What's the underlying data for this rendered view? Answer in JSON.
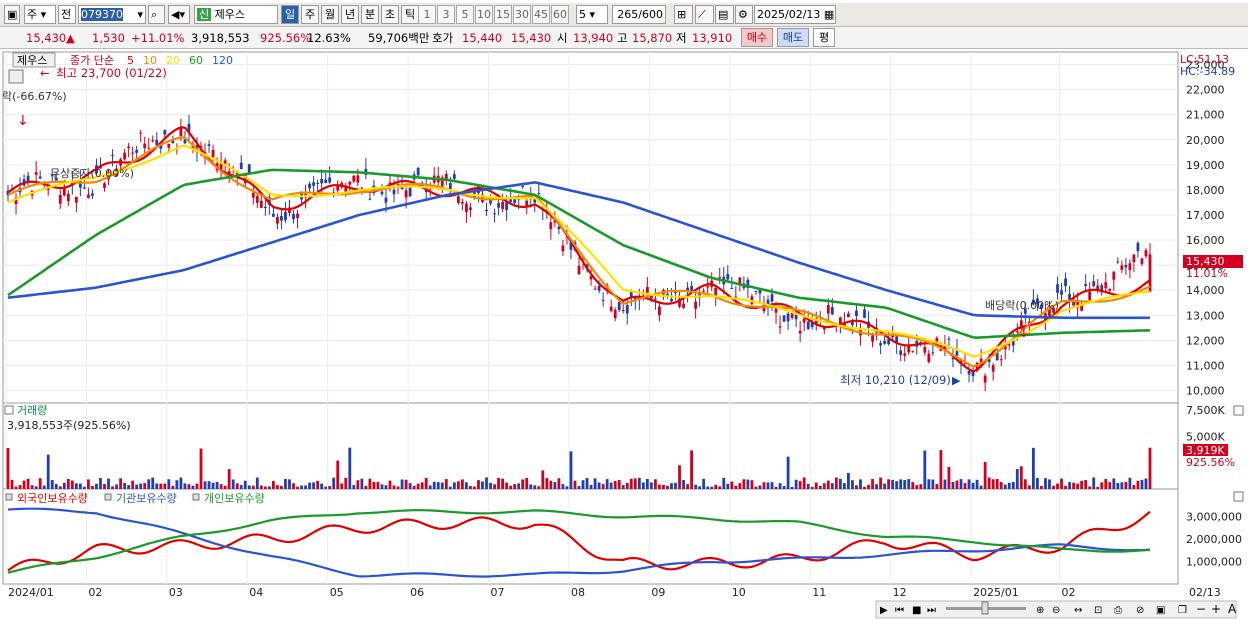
{
  "toolbar": {
    "market": "주",
    "scope": "전",
    "code": "079370",
    "tag": "신",
    "name": "제우스",
    "periods": [
      "일",
      "주",
      "월",
      "년",
      "분",
      "초",
      "틱"
    ],
    "active_period": "일",
    "nums": [
      "1",
      "3",
      "5",
      "10",
      "15",
      "30",
      "45",
      "60"
    ],
    "count_sel": "5",
    "bars": "265",
    "bars_total": "/600",
    "date": "2025/02/13"
  },
  "quote": {
    "price": "15,430",
    "arrow": "▲",
    "change": "1,530",
    "rate": "+11.01%",
    "volume": "3,918,553",
    "vol_ratio": "925.56%",
    "turnover": "12.63%",
    "amount": "59,706백만",
    "bid_label": "호가",
    "ask": "15,440",
    "bid": "15,430",
    "open_label": "시",
    "open": "13,940",
    "high_label": "고",
    "high": "15,870",
    "low_label": "저",
    "low": "13,910",
    "buy": "매수",
    "sell": "매도",
    "eval": "평"
  },
  "price_panel": {
    "stock_tag": "제우스",
    "legend_prefix": "종가 단순",
    "ma_periods": [
      {
        "label": "5",
        "color": "#e00000"
      },
      {
        "label": "10",
        "color": "#f08a00"
      },
      {
        "label": "20",
        "color": "#ffe000"
      },
      {
        "label": "60",
        "color": "#1a9a2a"
      },
      {
        "label": "120",
        "color": "#2a55d0"
      }
    ],
    "high_note": "최고 23,700 (01/22)",
    "low_note": "최저 10,210 (12/09)",
    "drop_note": "락(-66.67%)",
    "event1": "무상증자(0.00%)",
    "event2": "배당락(0.00%)",
    "lc": "LC:51.13",
    "hc": "HC:-34.89",
    "price_tag": "15,430",
    "pct_tag": "11.01%"
  },
  "volume_panel": {
    "title": "거래량",
    "value": "3,918,553주(925.56%)",
    "tag_value": "3,919K",
    "tag_pct": "925.56%",
    "axis": [
      "7,500K",
      "5,000K"
    ]
  },
  "holding_panel": {
    "legend": [
      {
        "label": "외국인보유수량",
        "color": "#e00000"
      },
      {
        "label": "기관보유수량",
        "color": "#2a55d0"
      },
      {
        "label": "개인보유수량",
        "color": "#1a9a2a"
      }
    ],
    "axis": [
      "3,000,000",
      "2,000,000",
      "1,000,000"
    ]
  },
  "xaxis": {
    "labels": [
      "2024/01",
      "02",
      "03",
      "04",
      "05",
      "06",
      "07",
      "08",
      "09",
      "10",
      "11",
      "12",
      "2025/01",
      "02",
      "02/13"
    ]
  },
  "colors": {
    "up": "#d2001e",
    "down": "#1f3fb0",
    "ma5": "#e00000",
    "ma10": "#f08a00",
    "ma20": "#ffe000",
    "ma60": "#1a9a2a",
    "ma120": "#2a55d0"
  },
  "chart_data": [
    {
      "type": "candlestick",
      "title": "제우스",
      "ylabel": "",
      "ylim": [
        9500,
        23500
      ],
      "y_ticks": [
        10000,
        11000,
        12000,
        13000,
        14000,
        15000,
        16000,
        17000,
        18000,
        19000,
        20000,
        21000,
        22000,
        23000
      ],
      "x": [
        "2024/01",
        "02",
        "03",
        "04",
        "05",
        "06",
        "07",
        "08",
        "09",
        "10",
        "11",
        "12",
        "2025/01",
        "02"
      ],
      "close_trend": [
        17800,
        18500,
        20500,
        17200,
        18300,
        18000,
        17600,
        13200,
        14100,
        13000,
        12300,
        11000,
        13600,
        15430
      ],
      "series": [
        {
          "name": "5",
          "values": [
            17900,
            18600,
            20300,
            17300,
            18200,
            18000,
            17500,
            13400,
            14000,
            13000,
            12300,
            11000,
            13500,
            14300
          ]
        },
        {
          "name": "10",
          "values": [
            17800,
            18500,
            20000,
            17500,
            18100,
            18000,
            17600,
            13600,
            13900,
            13000,
            12300,
            11100,
            13400,
            14100
          ]
        },
        {
          "name": "20",
          "values": [
            17500,
            18500,
            19800,
            17800,
            18000,
            18000,
            17700,
            14000,
            13800,
            13000,
            12400,
            11300,
            13200,
            13900
          ]
        },
        {
          "name": "60",
          "values": [
            13800,
            16200,
            18200,
            18800,
            18700,
            18400,
            17800,
            15800,
            14500,
            13700,
            13300,
            12100,
            12300,
            12400
          ]
        },
        {
          "name": "120",
          "values": [
            13700,
            14100,
            14800,
            15900,
            17000,
            17800,
            18300,
            17500,
            16300,
            15100,
            14000,
            13000,
            12900,
            12900
          ]
        }
      ],
      "annotations": [
        "최고 23,700 (01/22)",
        "최저 10,210 (12/09)"
      ]
    },
    {
      "type": "bar",
      "title": "거래량",
      "ylim": [
        0,
        7500000
      ],
      "y_ticks": [
        5000000,
        7500000
      ],
      "last_value": 3918553
    },
    {
      "type": "line",
      "title": "보유수량",
      "ylim": [
        0,
        3500000
      ],
      "y_ticks": [
        1000000,
        2000000,
        3000000
      ],
      "x": [
        "2024/01",
        "02",
        "03",
        "04",
        "05",
        "06",
        "07",
        "08",
        "09",
        "10",
        "11",
        "12",
        "2025/01",
        "02"
      ],
      "series": [
        {
          "name": "외국인보유수량",
          "values": [
            600000,
            1500000,
            1700000,
            2000000,
            2500000,
            2700000,
            2700000,
            900000,
            900000,
            1100000,
            1900000,
            1300000,
            1700000,
            3100000
          ]
        },
        {
          "name": "기관보유수량",
          "values": [
            3300000,
            3200000,
            2200000,
            1200000,
            400000,
            400000,
            400000,
            600000,
            1000000,
            1100000,
            1300000,
            1500000,
            1700000,
            1500000
          ]
        },
        {
          "name": "개인보유수량",
          "values": [
            500000,
            1200000,
            2100000,
            2800000,
            3200000,
            3200000,
            3200000,
            3000000,
            2900000,
            2700000,
            2100000,
            1900000,
            1500000,
            1500000
          ]
        }
      ]
    }
  ]
}
